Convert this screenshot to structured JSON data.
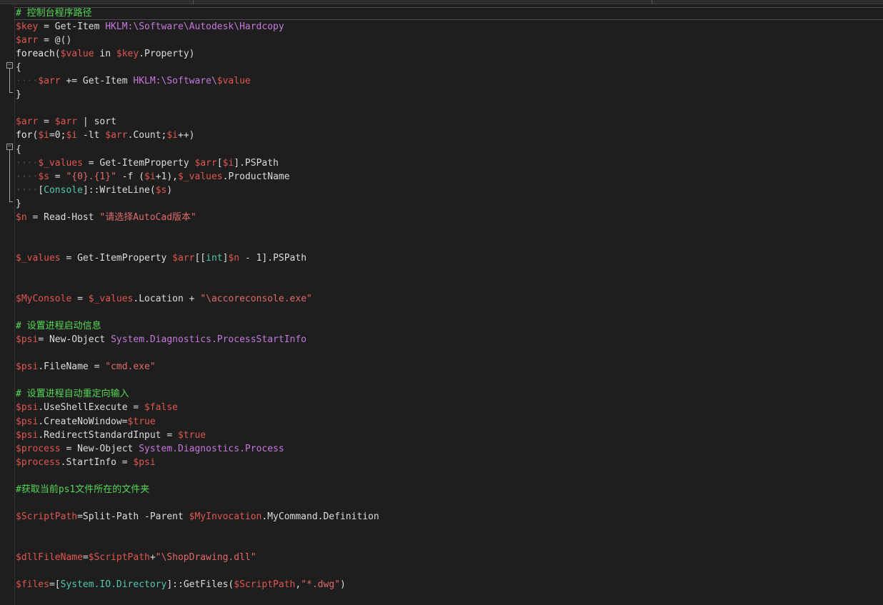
{
  "editor": {
    "lines": [
      "# 控制台程序路径",
      "$key = Get-Item HKLM:\\Software\\Autodesk\\Hardcopy",
      "$arr = @()",
      "foreach($value in $key.Property)",
      "{",
      "    $arr += Get-Item HKLM:\\Software\\$value",
      "}",
      "",
      "$arr = $arr | sort",
      "for($i=0;$i -lt $arr.Count;$i++)",
      "{",
      "    $_values = Get-ItemProperty $arr[$i].PSPath",
      "    $s = \"{0}.{1}\" -f ($i+1),$_values.ProductName",
      "    [Console]::WriteLine($s)",
      "}",
      "$n = Read-Host \"请选择AutoCad版本\"",
      "",
      "",
      "$_values = Get-ItemProperty $arr[[int]$n - 1].PSPath",
      "",
      "",
      "$MyConsole = $_values.Location + \"\\accoreconsole.exe\"",
      "",
      "# 设置进程启动信息",
      "$psi= New-Object System.Diagnostics.ProcessStartInfo",
      "",
      "$psi.FileName = \"cmd.exe\"",
      "",
      "# 设置进程自动重定向输入",
      "$psi.UseShellExecute = $false",
      "$psi.CreateNoWindow=$true",
      "$psi.RedirectStandardInput = $true",
      "$process = New-Object System.Diagnostics.Process",
      "$process.StartInfo = $psi",
      "",
      "#获取当前ps1文件所在的文件夹",
      "",
      "$ScriptPath=Split-Path -Parent $MyInvocation.MyCommand.Definition",
      "",
      "",
      "$dllFileName=$ScriptPath+\"\\ShopDrawing.dll\"",
      "",
      "$files=[System.IO.Directory]::GetFiles($ScriptPath,\"*.dwg\")"
    ]
  },
  "colors": {
    "background": "#1e1e1e",
    "variable": "#e0574f",
    "string": "#e16a6a",
    "type": "#c678dd",
    "comment": "#57d857",
    "bracket_type": "#4ec9b0"
  },
  "icons": {
    "fold": "minus-box-icon"
  }
}
